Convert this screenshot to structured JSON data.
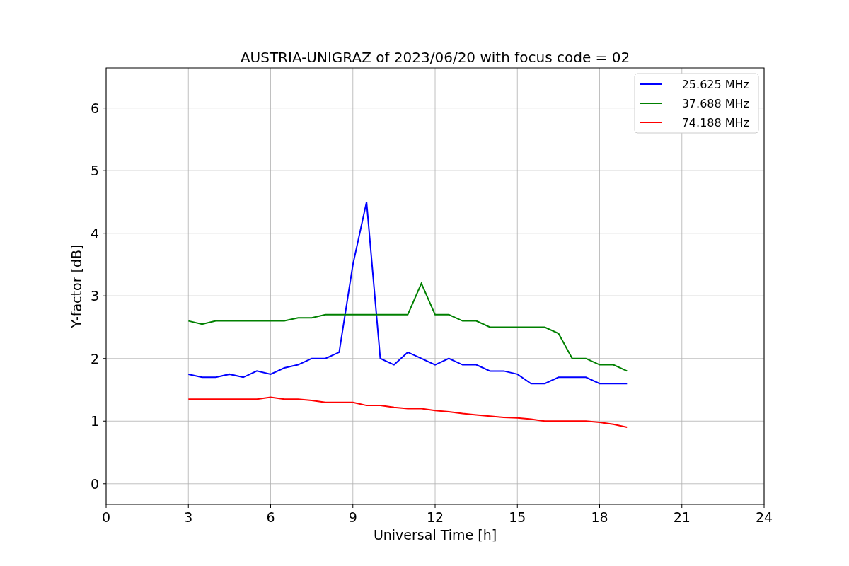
{
  "figure": {
    "chart_data": {
      "type": "line",
      "title": "AUSTRIA-UNIGRAZ of 2023/06/20 with focus code = 02",
      "xlabel": "Universal Time [h]",
      "ylabel": "Y-factor [dB]",
      "x": [
        3,
        3.5,
        4,
        4.5,
        5,
        5.5,
        6,
        6.5,
        7,
        7.5,
        8,
        8.5,
        9,
        9.5,
        10,
        10.5,
        11,
        11.5,
        12,
        12.5,
        13,
        13.5,
        14,
        14.5,
        15,
        15.5,
        16,
        16.5,
        17,
        17.5,
        18,
        18.5,
        19
      ],
      "series": [
        {
          "name": "25.625 MHz",
          "color": "#0000ff",
          "values": [
            1.75,
            1.7,
            1.7,
            1.75,
            1.7,
            1.8,
            1.75,
            1.85,
            1.9,
            2.0,
            2.0,
            2.1,
            3.5,
            4.5,
            2.0,
            1.9,
            2.1,
            2.0,
            1.9,
            2.0,
            1.9,
            1.9,
            1.8,
            1.8,
            1.75,
            1.6,
            1.6,
            1.7,
            1.7,
            1.7,
            1.6,
            1.6,
            1.6
          ]
        },
        {
          "name": "37.688 MHz",
          "color": "#008000",
          "values": [
            2.6,
            2.55,
            2.6,
            2.6,
            2.6,
            2.6,
            2.6,
            2.6,
            2.65,
            2.65,
            2.7,
            2.7,
            2.7,
            2.7,
            2.7,
            2.7,
            2.7,
            3.2,
            2.7,
            2.7,
            2.6,
            2.6,
            2.5,
            2.5,
            2.5,
            2.5,
            2.5,
            2.4,
            2.0,
            2.0,
            1.9,
            1.9,
            1.8
          ]
        },
        {
          "name": "74.188 MHz",
          "color": "#ff0000",
          "values": [
            1.35,
            1.35,
            1.35,
            1.35,
            1.35,
            1.35,
            1.38,
            1.35,
            1.35,
            1.33,
            1.3,
            1.3,
            1.3,
            1.25,
            1.25,
            1.22,
            1.2,
            1.2,
            1.17,
            1.15,
            1.12,
            1.1,
            1.08,
            1.06,
            1.05,
            1.03,
            1.0,
            1.0,
            1.0,
            1.0,
            0.98,
            0.95,
            0.9
          ]
        }
      ],
      "xlim": [
        0,
        24
      ],
      "ylim": [
        -0.33,
        6.64
      ],
      "xticks": [
        0,
        3,
        6,
        9,
        12,
        15,
        18,
        21,
        24
      ],
      "yticks": [
        0,
        1,
        2,
        3,
        4,
        5,
        6
      ],
      "grid": true,
      "legend": "upper right"
    }
  }
}
